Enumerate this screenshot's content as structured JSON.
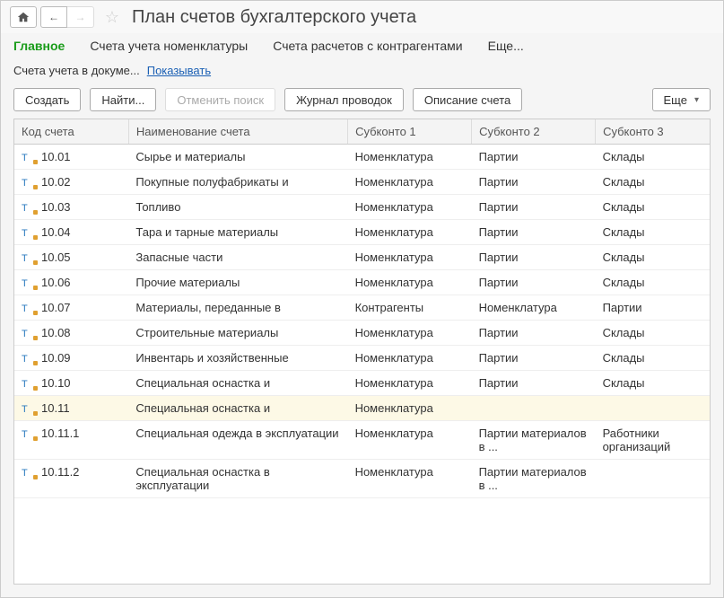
{
  "title": "План счетов бухгалтерского учета",
  "tabs": {
    "main": "Главное",
    "nom": "Счета учета номенклатуры",
    "contr": "Счета расчетов с контрагентами",
    "more": "Еще..."
  },
  "subrow": {
    "label": "Счета учета в докуме...",
    "link": "Показывать"
  },
  "toolbar": {
    "create": "Создать",
    "find": "Найти...",
    "cancel_search": "Отменить поиск",
    "journal": "Журнал проводок",
    "desc": "Описание счета",
    "more": "Еще"
  },
  "columns": {
    "code": "Код счета",
    "name": "Наименование счета",
    "s1": "Субконто 1",
    "s2": "Субконто 2",
    "s3": "Субконто 3"
  },
  "rows": [
    {
      "code": "10.01",
      "name": "Сырье и материалы",
      "s1": "Номенклатура",
      "s2": "Партии",
      "s3": "Склады",
      "sel": false
    },
    {
      "code": "10.02",
      "name": "Покупные полуфабрикаты и",
      "s1": "Номенклатура",
      "s2": "Партии",
      "s3": "Склады",
      "sel": false
    },
    {
      "code": "10.03",
      "name": "Топливо",
      "s1": "Номенклатура",
      "s2": "Партии",
      "s3": "Склады",
      "sel": false
    },
    {
      "code": "10.04",
      "name": "Тара и тарные материалы",
      "s1": "Номенклатура",
      "s2": "Партии",
      "s3": "Склады",
      "sel": false
    },
    {
      "code": "10.05",
      "name": "Запасные части",
      "s1": "Номенклатура",
      "s2": "Партии",
      "s3": "Склады",
      "sel": false
    },
    {
      "code": "10.06",
      "name": "Прочие материалы",
      "s1": "Номенклатура",
      "s2": "Партии",
      "s3": "Склады",
      "sel": false
    },
    {
      "code": "10.07",
      "name": "Материалы, переданные в",
      "s1": "Контрагенты",
      "s2": "Номенклатура",
      "s3": "Партии",
      "sel": false
    },
    {
      "code": "10.08",
      "name": "Строительные материалы",
      "s1": "Номенклатура",
      "s2": "Партии",
      "s3": "Склады",
      "sel": false
    },
    {
      "code": "10.09",
      "name": "Инвентарь и хозяйственные",
      "s1": "Номенклатура",
      "s2": "Партии",
      "s3": "Склады",
      "sel": false
    },
    {
      "code": "10.10",
      "name": "Специальная оснастка и",
      "s1": "Номенклатура",
      "s2": "Партии",
      "s3": "Склады",
      "sel": false
    },
    {
      "code": "10.11",
      "name": "Специальная оснастка и",
      "s1": "Номенклатура",
      "s2": "",
      "s3": "",
      "sel": true
    },
    {
      "code": "10.11.1",
      "name": "Специальная одежда в эксплуатации",
      "s1": "Номенклатура",
      "s2": "Партии материалов в ...",
      "s3": "Работники организаций",
      "sel": false
    },
    {
      "code": "10.11.2",
      "name": "Специальная оснастка в эксплуатации",
      "s1": "Номенклатура",
      "s2": "Партии материалов в ...",
      "s3": "",
      "sel": false
    }
  ]
}
